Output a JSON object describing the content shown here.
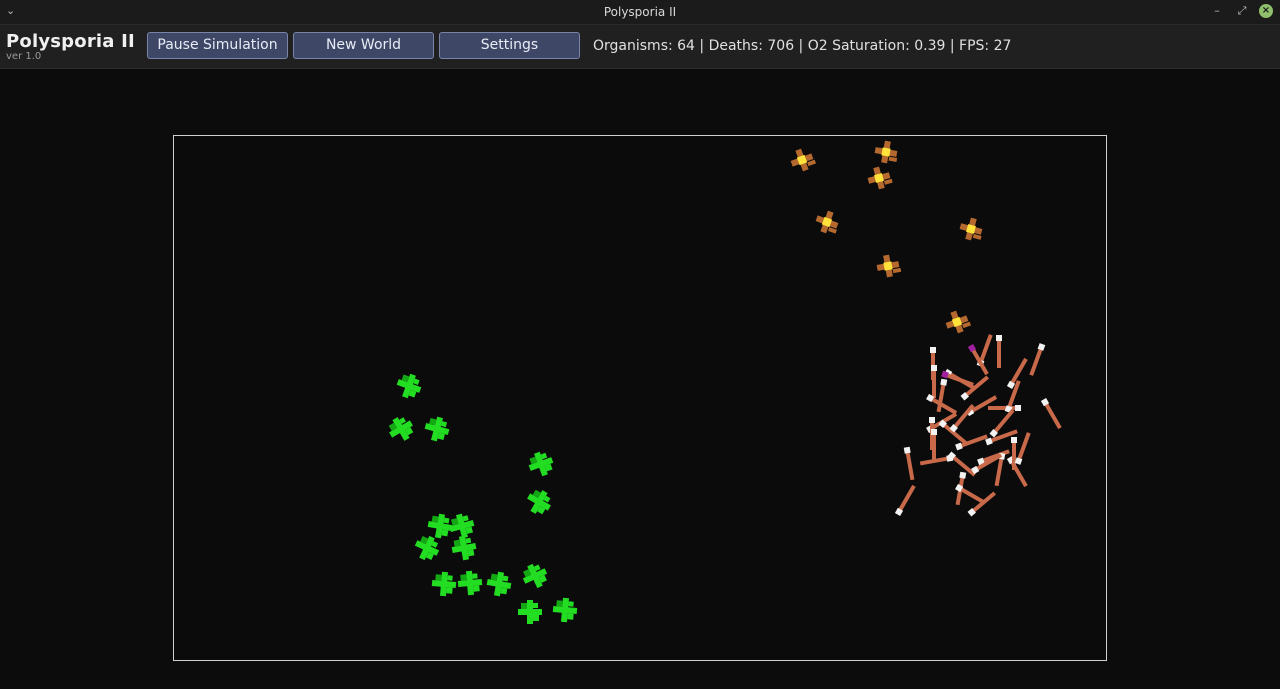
{
  "window": {
    "title": "Polysporia II",
    "menu_glyph": "⌄",
    "minimize_glyph": "–",
    "maximize_glyph": "⤢",
    "close_glyph": "×"
  },
  "app": {
    "name": "Polysporia II",
    "version": "ver 1.0"
  },
  "toolbar": {
    "pause_label": "Pause Simulation",
    "new_world_label": "New World",
    "settings_label": "Settings"
  },
  "stats": {
    "text": "Organisms: 64 | Deaths: 706 | O2 Saturation: 0.39 | FPS: 27",
    "organisms": 64,
    "deaths": 706,
    "o2_saturation": 0.39,
    "fps": 27
  },
  "colors": {
    "plant": "#22dd22",
    "plant_dark": "#14a814",
    "predator_body": "#c8694a",
    "predator_head": "#f2f2f2",
    "predator_mouth": "#a020a0",
    "fungus_body": "#b5692e",
    "fungus_core": "#ffe23a",
    "border": "#d0d0d0"
  }
}
